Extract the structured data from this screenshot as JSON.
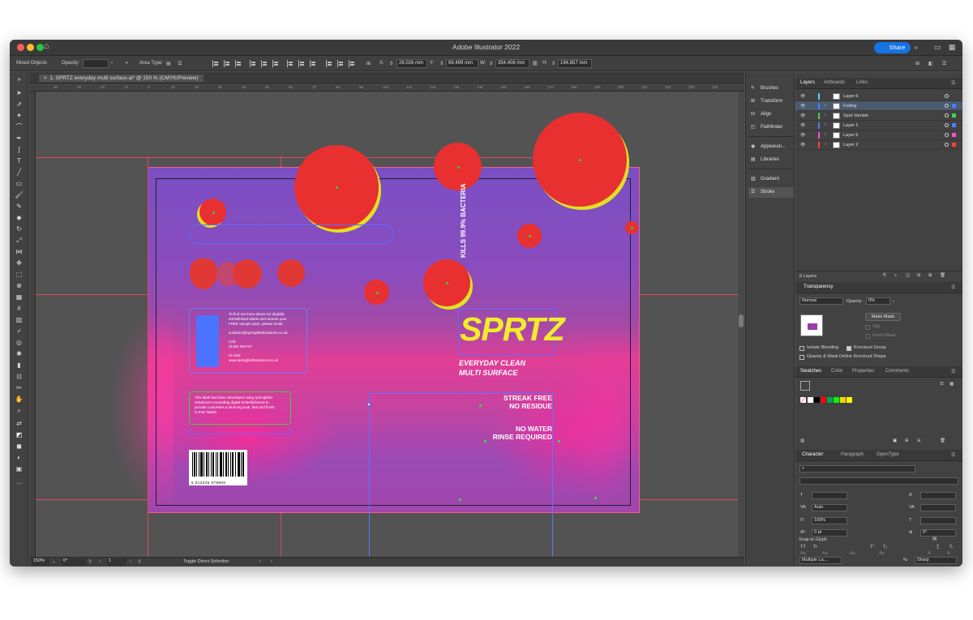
{
  "window": {
    "title": "Adobe Illustrator 2022",
    "share_label": "Share"
  },
  "controlbar": {
    "selection": "Mixed Objects",
    "opacity_label": "Opacity:",
    "area_type_label": "Area Type:",
    "x_label": "X:",
    "x_value": "26.026 mm",
    "y_label": "Y:",
    "y_value": "69.499 mm",
    "w_label": "W:",
    "w_value": "354.408 mm",
    "h_label": "H:",
    "h_value": "194.857 mm"
  },
  "doc": {
    "tab_title": "1. SPRTZ everyday multi surface.ai* @ 150 % (CMYK/Preview)"
  },
  "ruler": {
    "h_ticks": [
      "40",
      "30",
      "20",
      "10",
      "0",
      "10",
      "20",
      "30",
      "40",
      "50",
      "60",
      "70",
      "80",
      "90",
      "100",
      "110",
      "120",
      "130",
      "140",
      "150",
      "160",
      "170",
      "180",
      "190",
      "200",
      "210",
      "220",
      "230",
      "240"
    ]
  },
  "artwork": {
    "brand": "SPRTZ",
    "tagline_1": "EVERYDAY CLEAN",
    "tagline_2": "MULTI SURFACE",
    "kills_text": "KILLS 99.9% BACTERIA",
    "streak_1": "STREAK FREE",
    "streak_2": "NO RESIDUE",
    "water_1": "NO WATER",
    "water_2": "RINSE REQUIRED",
    "info_line_1": "To find out more about our digitally",
    "info_line_2": "embellished labels and recieve your",
    "info_line_3": "FREE sample pack, please email:",
    "info_email": "solutions@springfieldsolutions.co.uk",
    "info_call_label": "Call:",
    "info_phone": "01482 454747",
    "info_visit_label": "Or visit:",
    "info_web": "www.springfieldsolutions.co.uk",
    "note_line_1": "This label has been developed using Springfield",
    "note_line_2": "Solutions's exceeding digital embellishment to",
    "note_line_3": "provide customers a stunning look, feel and finish",
    "note_line_4": "to their labels.",
    "barcode_number": "5 012345 678900"
  },
  "statusbar": {
    "zoom": "150%",
    "rotation": "0°",
    "artboard": "1",
    "tool_hint": "Toggle Direct Selection"
  },
  "dock": {
    "items": [
      "Brushes",
      "Transform",
      "Align",
      "Pathfinder",
      "Appearan...",
      "Libraries",
      "Gradient",
      "Stroke"
    ]
  },
  "layers_panel": {
    "tabs": [
      "Layers",
      "Artboards",
      "Links"
    ],
    "layers": [
      {
        "name": "Layer 6",
        "color": "#4fd5ff"
      },
      {
        "name": "Foiling",
        "color": "#4f7cff"
      },
      {
        "name": "Spot Varnish",
        "color": "#3dd24f"
      },
      {
        "name": "Layer 1",
        "color": "#4f7cff"
      },
      {
        "name": "Layer 5",
        "color": "#ff4fd5"
      },
      {
        "name": "Layer 2",
        "color": "#ff3c3c"
      }
    ],
    "count_label": "6 Layers"
  },
  "transparency": {
    "title": "Transparency",
    "mode": "Normal",
    "opacity_label": "Opacity:",
    "opacity_value": "0%",
    "make_mask": "Make Mask",
    "clip": "Clip",
    "invert_mask": "Invert Mask",
    "isolate": "Isolate Blending",
    "knockout": "Knockout Group",
    "opacity_mask": "Opacity & Mask Define Knockout Shape"
  },
  "swatches": {
    "tabs": [
      "Swatches",
      "Color",
      "Properties",
      "Comments"
    ],
    "colors": [
      "#ffffff",
      "#000000",
      "#ff0000",
      "#00a651",
      "#00ff00",
      "#ffd400",
      "#ffff00"
    ]
  },
  "character": {
    "tabs": [
      "Character",
      "Paragraph",
      "OpenType"
    ],
    "leading": "Auto",
    "scale_v": "100%",
    "tracking": "0 pt",
    "rotation": "0°",
    "language": "Multiple La...",
    "aa": "Sharp",
    "snap": "Snap to Glyph"
  }
}
